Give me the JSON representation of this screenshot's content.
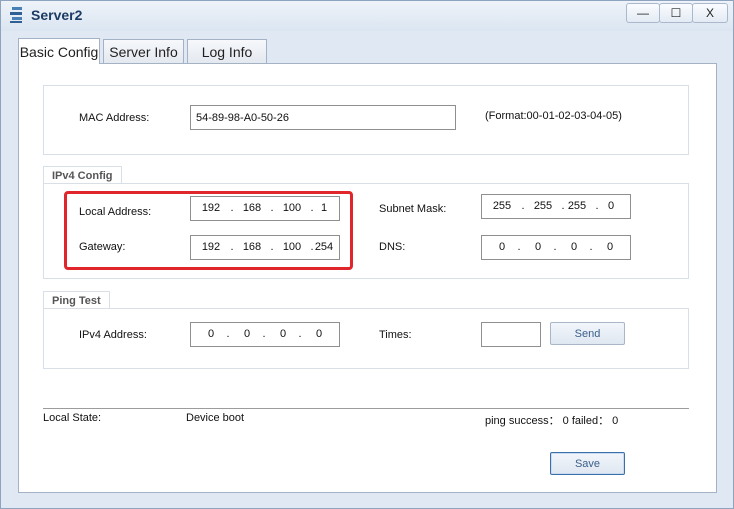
{
  "window": {
    "title": "Server2",
    "min_icon": "minimize-icon",
    "max_icon": "maximize-icon",
    "close_icon": "close-icon",
    "min_glyph": "—",
    "max_glyph": "☐",
    "close_glyph": "X"
  },
  "tabs": [
    {
      "label": "Basic Config",
      "active": true
    },
    {
      "label": "Server Info",
      "active": false
    },
    {
      "label": "Log Info",
      "active": false
    }
  ],
  "mac": {
    "label": "MAC Address:",
    "value": "54-89-98-A0-50-26",
    "format_hint": "(Format:00-01-02-03-04-05)"
  },
  "ipv4": {
    "group_title": "IPv4 Config",
    "local_address": {
      "label": "Local Address:",
      "octets": [
        "192",
        "168",
        "100",
        "1"
      ]
    },
    "gateway": {
      "label": "Gateway:",
      "octets": [
        "192",
        "168",
        "100",
        "254"
      ]
    },
    "subnet_mask": {
      "label": "Subnet Mask:",
      "octets": [
        "255",
        "255",
        "255",
        "0"
      ]
    },
    "dns": {
      "label": "DNS:",
      "octets": [
        "0",
        "0",
        "0",
        "0"
      ]
    }
  },
  "ping": {
    "group_title": "Ping Test",
    "ipv4": {
      "label": "IPv4 Address:",
      "octets": [
        "0",
        "0",
        "0",
        "0"
      ]
    },
    "times_label": "Times:",
    "times_value": "",
    "send_label": "Send"
  },
  "status": {
    "state_label": "Local State:",
    "state_value": "Device boot",
    "ping_result": "ping success\u0003 0 failed\u0003 0"
  },
  "save_label": "Save",
  "colors": {
    "highlight": "#e0262a",
    "title_text": "#1d3c63",
    "button_text": "#3a5f8a"
  }
}
